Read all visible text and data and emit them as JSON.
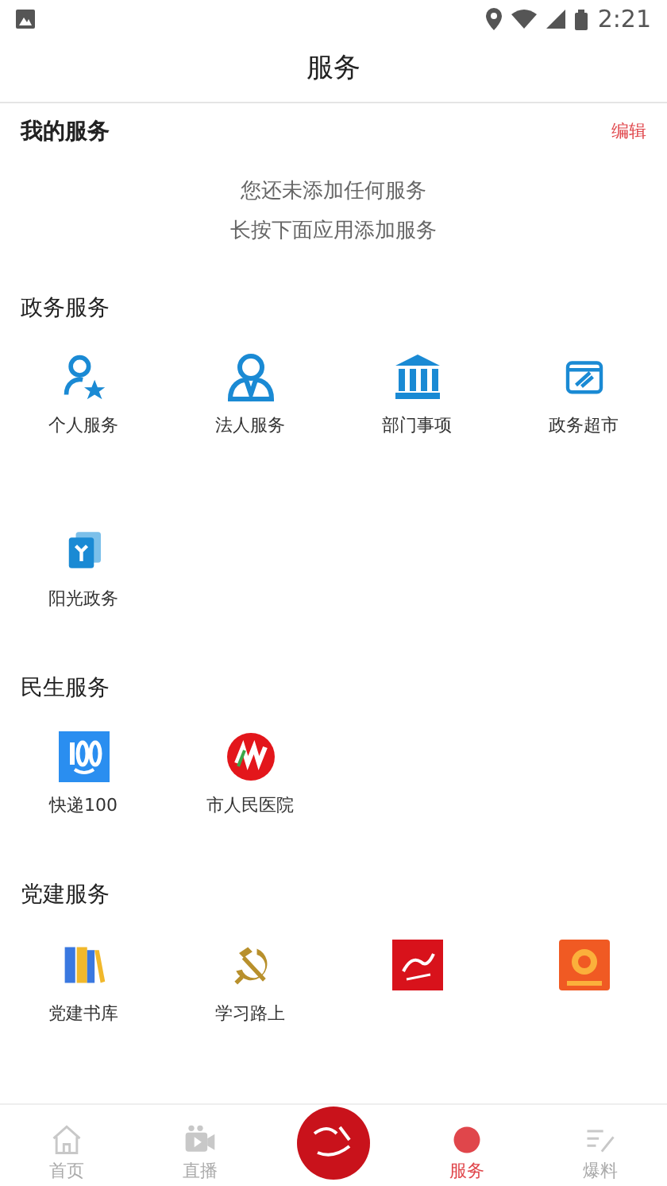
{
  "status_bar": {
    "time": "2:21"
  },
  "header": {
    "title": "服务"
  },
  "my_services": {
    "title": "我的服务",
    "edit": "编辑",
    "empty_lines": [
      "您还未添加任何服务",
      "长按下面应用添加服务"
    ]
  },
  "sections": [
    {
      "title": "政务服务",
      "items": [
        {
          "label": "个人服务",
          "kind": "person-star"
        },
        {
          "label": "法人服务",
          "kind": "person-tie"
        },
        {
          "label": "部门事项",
          "kind": "bank"
        },
        {
          "label": "政务超市",
          "kind": "shop"
        },
        {
          "label": "阳光政务",
          "kind": "card"
        }
      ]
    },
    {
      "title": "民生服务",
      "items": [
        {
          "label": "快递100",
          "kind": "express"
        },
        {
          "label": "市人民医院",
          "kind": "hospital"
        }
      ]
    },
    {
      "title": "党建服务",
      "items": [
        {
          "label": "党建书库",
          "kind": "books"
        },
        {
          "label": "学习路上",
          "kind": "hammer-sickle"
        },
        {
          "kind": "red-square"
        },
        {
          "kind": "orange-square"
        }
      ]
    }
  ],
  "bottom_nav": [
    {
      "kind": "home",
      "label": "首页",
      "selected": false
    },
    {
      "kind": "video",
      "label": "直播",
      "selected": false
    },
    {
      "kind": "center",
      "selected": false
    },
    {
      "kind": "service",
      "label": "服务",
      "selected": true
    },
    {
      "kind": "edit",
      "label": "爆料",
      "selected": false
    }
  ]
}
